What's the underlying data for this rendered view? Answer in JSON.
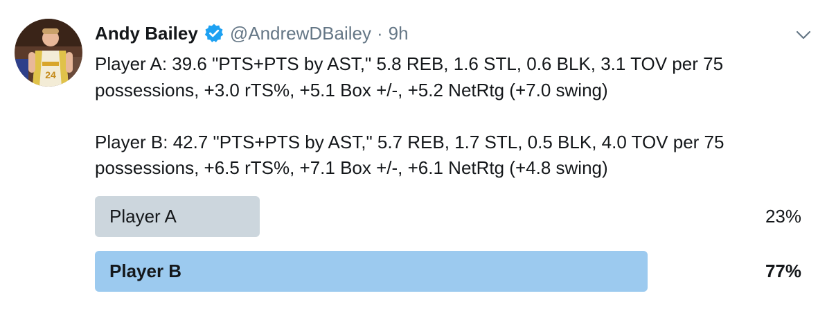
{
  "tweet": {
    "author": {
      "display_name": "Andy Bailey",
      "handle": "@AndrewDBailey",
      "verified": true,
      "avatar_icon": "avatar-photo"
    },
    "separator": "·",
    "time": "9h",
    "menu_icon": "chevron-down-icon",
    "paragraphs": [
      "Player A: 39.6 \"PTS+PTS by AST,\" 5.8 REB, 1.6 STL, 0.6 BLK, 3.1 TOV per 75 possessions, +3.0 rTS%, +5.1 Box +/-, +5.2 NetRtg (+7.0 swing)",
      "Player B: 42.7 \"PTS+PTS by AST,\" 5.7 REB, 1.7 STL, 0.5 BLK, 4.0 TOV per 75 possessions, +6.5 rTS%, +7.1 Box +/-, +6.1 NetRtg (+4.8 swing)"
    ]
  },
  "poll": {
    "options": [
      {
        "label": "Player A",
        "percent_text": "23%",
        "percent": 23,
        "winner": false,
        "bar_color": "#ccd6dd"
      },
      {
        "label": "Player B",
        "percent_text": "77%",
        "percent": 77,
        "winner": true,
        "bar_color": "#9ccaef"
      }
    ]
  },
  "colors": {
    "text": "#14171a",
    "secondary": "#657786",
    "verified_badge": "#1da1f2",
    "loser_bar": "#ccd6dd",
    "winner_bar": "#9ccaef"
  }
}
